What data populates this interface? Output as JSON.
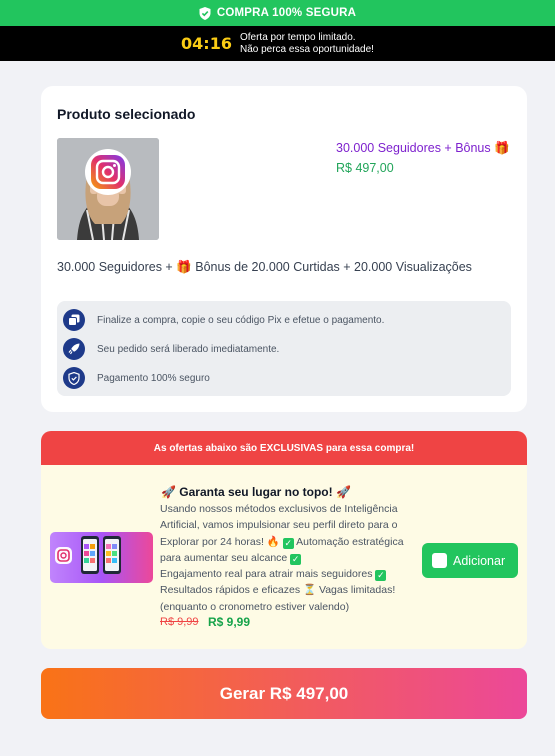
{
  "banner": {
    "text": "COMPRA 100% SEGURA",
    "icon": "shield-check-icon"
  },
  "timer_bar": {
    "time": "04:16",
    "line1": "Oferta por tempo limitado.",
    "line2": "Não perca essa oportunidade!"
  },
  "product": {
    "section_title": "Produto selecionado",
    "name": "30.000 Seguidores + Bônus 🎁",
    "price": "R$ 497,00",
    "description": "30.000 Seguidores + 🎁 Bônus de 20.000 Curtidas + 20.000 Visualizações"
  },
  "info": [
    {
      "icon": "copy-icon",
      "text": "Finalize a compra, copie o seu código Pix e efetue o pagamento."
    },
    {
      "icon": "rocket-icon",
      "text": "Seu pedido será liberado imediatamente."
    },
    {
      "icon": "shield-icon",
      "text": "Pagamento 100% seguro"
    }
  ],
  "offer": {
    "header": "As ofertas abaixo são EXCLUSIVAS para essa compra!",
    "title": "🚀 Garanta seu lugar no topo! 🚀",
    "body": {
      "p1": "Usando nossos métodos exclusivos de Inteligência Artificial, vamos impulsionar seu perfil direto para o Explorar por 24 horas! 🔥 ",
      "p2": " Automação estratégica para aumentar seu alcance ",
      "p3": "Engajamento real para atrair mais seguidores ",
      "p4": "Resultados rápidos e eficazes ⏳ Vagas limitadas! (enquanto o cronometro estiver valendo)"
    },
    "old_price": "R$ 9,99",
    "new_price": "R$ 9,99",
    "button": "Adicionar"
  },
  "generate_button": "Gerar R$ 497,00",
  "colors": {
    "green": "#22c55e",
    "purple": "#7e22ce",
    "red": "#ef4444",
    "gradient_start": "#f97316",
    "gradient_end": "#ec4899"
  }
}
